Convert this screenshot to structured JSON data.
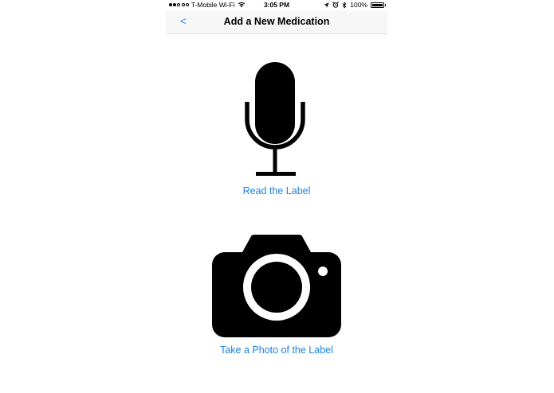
{
  "status_bar": {
    "signal_dots_filled": 2,
    "signal_dots_total": 5,
    "carrier": "T-Mobile Wi-Fi",
    "time": "3:05 PM",
    "battery": "100%",
    "battery_level_percent": 100
  },
  "nav": {
    "back_label": "<",
    "title": "Add a New Medication"
  },
  "options": {
    "read_label": "Read the Label",
    "photo_label": "Take a Photo of the Label"
  },
  "colors": {
    "accent": "#1a82e0",
    "nav_background": "#f7f7f7",
    "icon": "#000000"
  },
  "icons": [
    "wifi-icon",
    "location-arrow-icon",
    "alarm-icon",
    "bluetooth-icon",
    "battery-icon",
    "microphone-icon",
    "camera-icon"
  ]
}
